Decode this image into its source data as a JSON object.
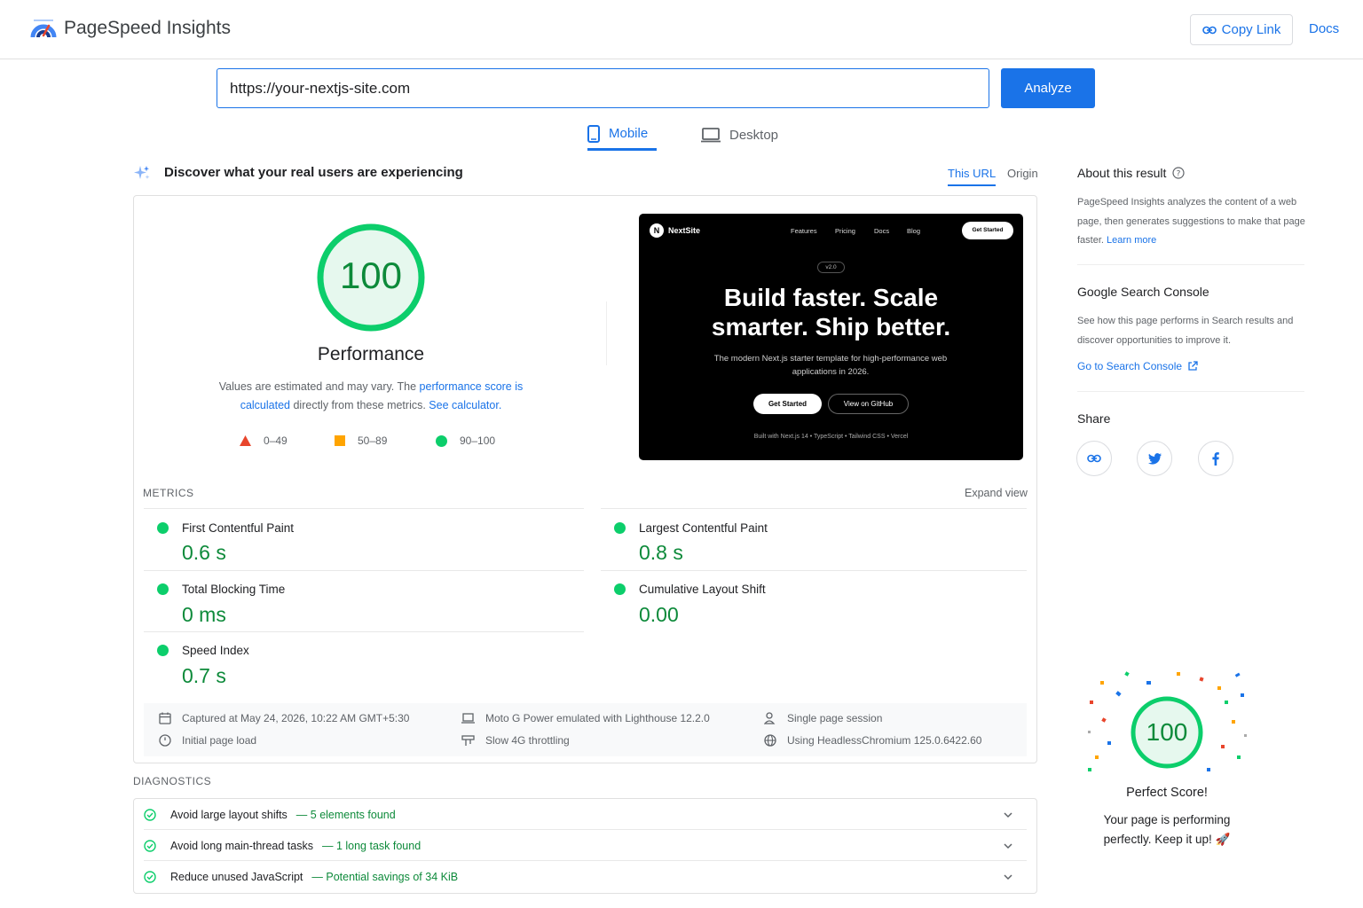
{
  "header": {
    "brand": "PageSpeed Insights",
    "copy_link": "Copy Link",
    "docs": "Docs"
  },
  "search": {
    "url": "https://your-nextjs-site.com",
    "analyze": "Analyze"
  },
  "tabs": {
    "mobile": "Mobile",
    "desktop": "Desktop",
    "active": "Mobile"
  },
  "field": {
    "heading": "Discover what your real users are experiencing",
    "this_url": "This URL",
    "origin": "Origin"
  },
  "performance": {
    "score": "100",
    "label": "Performance",
    "note_prefix": "Values are estimated and may vary. The ",
    "note_link1": "performance score is calculated",
    "note_mid": " directly from these metrics. ",
    "note_link2": "See calculator.",
    "legend": [
      {
        "range": "0–49",
        "color": "#e8452c"
      },
      {
        "range": "50–89",
        "color": "#ffa400"
      },
      {
        "range": "90–100",
        "color": "#0cce6b"
      }
    ]
  },
  "screenshot": {
    "logo_letter": "N",
    "site_name": "NextSite",
    "nav": [
      "Features",
      "Pricing",
      "Docs",
      "Blog"
    ],
    "nav_cta": "Get Started",
    "badge": "v2.0",
    "headline_line1": "Build faster. Scale",
    "headline_line2": "smarter. Ship better.",
    "sub": "The modern Next.js starter template for high-performance web applications in 2026.",
    "btn_primary": "Get Started",
    "btn_secondary": "View on GitHub",
    "built_with": "Built with Next.js 14  •  TypeScript  •  Tailwind CSS  •  Vercel"
  },
  "metrics": {
    "label": "METRICS",
    "expand": "Expand view",
    "items": [
      {
        "name": "First Contentful Paint",
        "value": "0.6 s"
      },
      {
        "name": "Largest Contentful Paint",
        "value": "0.8 s"
      },
      {
        "name": "Total Blocking Time",
        "value": "0 ms"
      },
      {
        "name": "Cumulative Layout Shift",
        "value": "0.00"
      },
      {
        "name": "Speed Index",
        "value": "0.7 s"
      }
    ]
  },
  "run_info": {
    "captured": "Captured at May 24, 2026, 10:22 AM GMT+5:30",
    "load": "Initial page load",
    "device": "Moto G Power emulated with Lighthouse 12.2.0",
    "throttling": "Slow 4G throttling",
    "session": "Single page session",
    "browser": "Using HeadlessChromium 125.0.6422.60"
  },
  "diagnostics": {
    "label": "DIAGNOSTICS",
    "items": [
      {
        "title": "Avoid large layout shifts",
        "detail": "— 5 elements found"
      },
      {
        "title": "Avoid long main-thread tasks",
        "detail": "— 1 long task found"
      },
      {
        "title": "Reduce unused JavaScript",
        "detail": "— Potential savings of 34 KiB"
      }
    ]
  },
  "sidebar": {
    "about_title": "About this result",
    "about_text": "PageSpeed Insights analyzes the content of a web page, then generates suggestions to make that page faster. ",
    "learn_more": "Learn more",
    "gsc_title": "Google Search Console",
    "gsc_text": "See how this page performs in Search results and discover opportunities to improve it.",
    "gsc_link": "Go to Search Console",
    "share_title": "Share",
    "perfect_score": "100",
    "perfect_title": "Perfect Score!",
    "perfect_text": "Your page is performing perfectly. Keep it up! 🚀"
  },
  "colors": {
    "accent": "#1a73e8",
    "pass": "#0cce6b",
    "pass_text": "#0d8a3a"
  }
}
